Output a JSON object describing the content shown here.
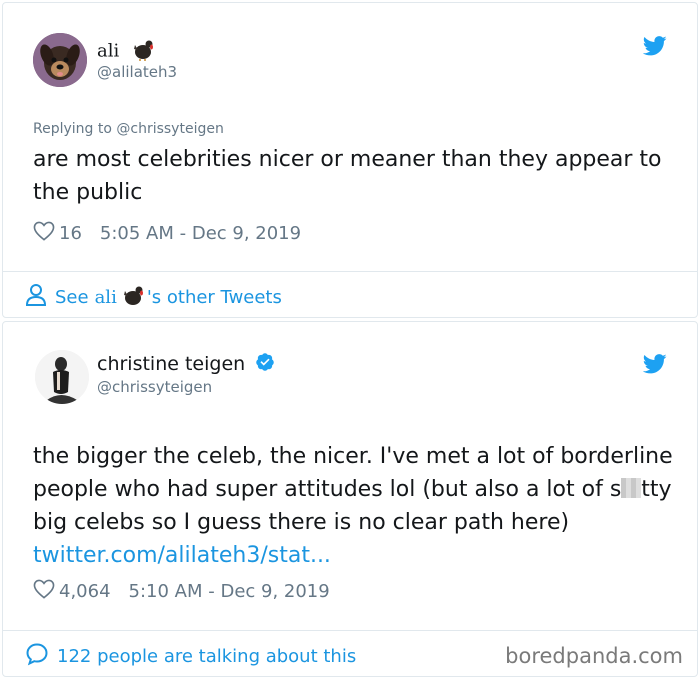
{
  "tweet1": {
    "display_name": "ali",
    "display_emoji": "turkey-emoji",
    "handle": "@alilateh3",
    "replying_to": "Replying to @chrissyteigen",
    "text": "are most celebrities nicer or meaner than they appear to the public",
    "likes": "16",
    "timestamp": "5:05 AM - Dec 9, 2019",
    "footer_prefix": "See",
    "footer_name": "ali",
    "footer_suffix": "'s other Tweets"
  },
  "tweet2": {
    "display_name": "christine teigen",
    "verified": true,
    "handle": "@chrissyteigen",
    "text_part1": "the bigger the celeb, the nicer. I've met a lot of borderline people who had super attitudes lol (but also a lot of s",
    "text_part2": "tty big celebs so I guess there is no clear path here) ",
    "link": "twitter.com/alilateh3/stat...",
    "likes": "4,064",
    "timestamp": "5:10 AM - Dec 9, 2019",
    "footer": "122 people are talking about this"
  },
  "watermark": "boredpanda.com",
  "colors": {
    "twitter_blue": "#1b95e0",
    "secondary_text": "#657786",
    "border": "#e1e8ed",
    "verified_blue": "#1da1f2"
  }
}
